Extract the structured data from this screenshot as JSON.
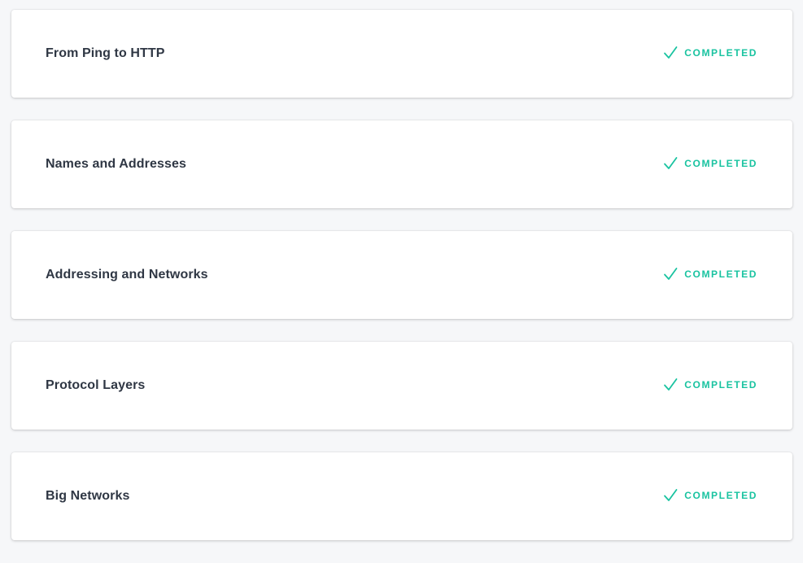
{
  "colors": {
    "completed": "#19c3a0",
    "title": "#2f3744",
    "background": "#f6f7f9",
    "card": "#ffffff"
  },
  "lessons": [
    {
      "title": "From Ping to HTTP",
      "status": "COMPLETED",
      "status_icon": "check-icon"
    },
    {
      "title": "Names and Addresses",
      "status": "COMPLETED",
      "status_icon": "check-icon"
    },
    {
      "title": "Addressing and Networks",
      "status": "COMPLETED",
      "status_icon": "check-icon"
    },
    {
      "title": "Protocol Layers",
      "status": "COMPLETED",
      "status_icon": "check-icon"
    },
    {
      "title": "Big Networks",
      "status": "COMPLETED",
      "status_icon": "check-icon"
    }
  ]
}
